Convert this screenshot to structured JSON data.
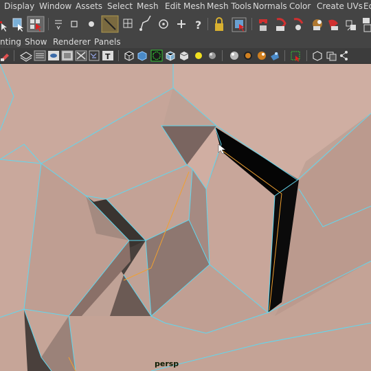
{
  "menus": [
    "Display",
    "Window",
    "Assets",
    "Select",
    "Mesh",
    "Edit Mesh",
    "Mesh Tools",
    "Normals",
    "Color",
    "Create UVs",
    "Ed"
  ],
  "panel_menus": [
    "nting",
    "Show",
    "Renderer",
    "Panels"
  ],
  "camera_label": "persp",
  "colors": {
    "ui_bg": "#444444",
    "mesh": "#c8a89c",
    "wire": "#5fd8f0",
    "selected_edge": "#f0a030",
    "shadow": "#3a302c"
  },
  "icons": {
    "shelf": [
      "select-tool-icon",
      "lasso-icon",
      "paint-select-icon",
      "soft-select-icon",
      "pivot-icon",
      "object-mode-icon",
      "component-mode-icon",
      "multi-edit-icon",
      "snap-grid-icon",
      "snap-curve-icon",
      "snap-point-icon",
      "snap-plane-icon",
      "help-icon",
      "lock-icon",
      "magnet-icon",
      "history-icon",
      "render-icon",
      "ipr-render-icon",
      "render-settings-icon",
      "hypershade-icon",
      "render-view-icon"
    ],
    "viewport": [
      "camera-icon",
      "wireframe-icon",
      "smooth-shade-icon",
      "flat-shade-icon",
      "bounding-box-icon",
      "texture-icon",
      "default-material-icon",
      "lights-icon",
      "shadow-icon",
      "isolate-icon",
      "xray-icon",
      "grid-icon",
      "hud-icon",
      "resolution-gate-icon",
      "film-gate-icon"
    ]
  }
}
